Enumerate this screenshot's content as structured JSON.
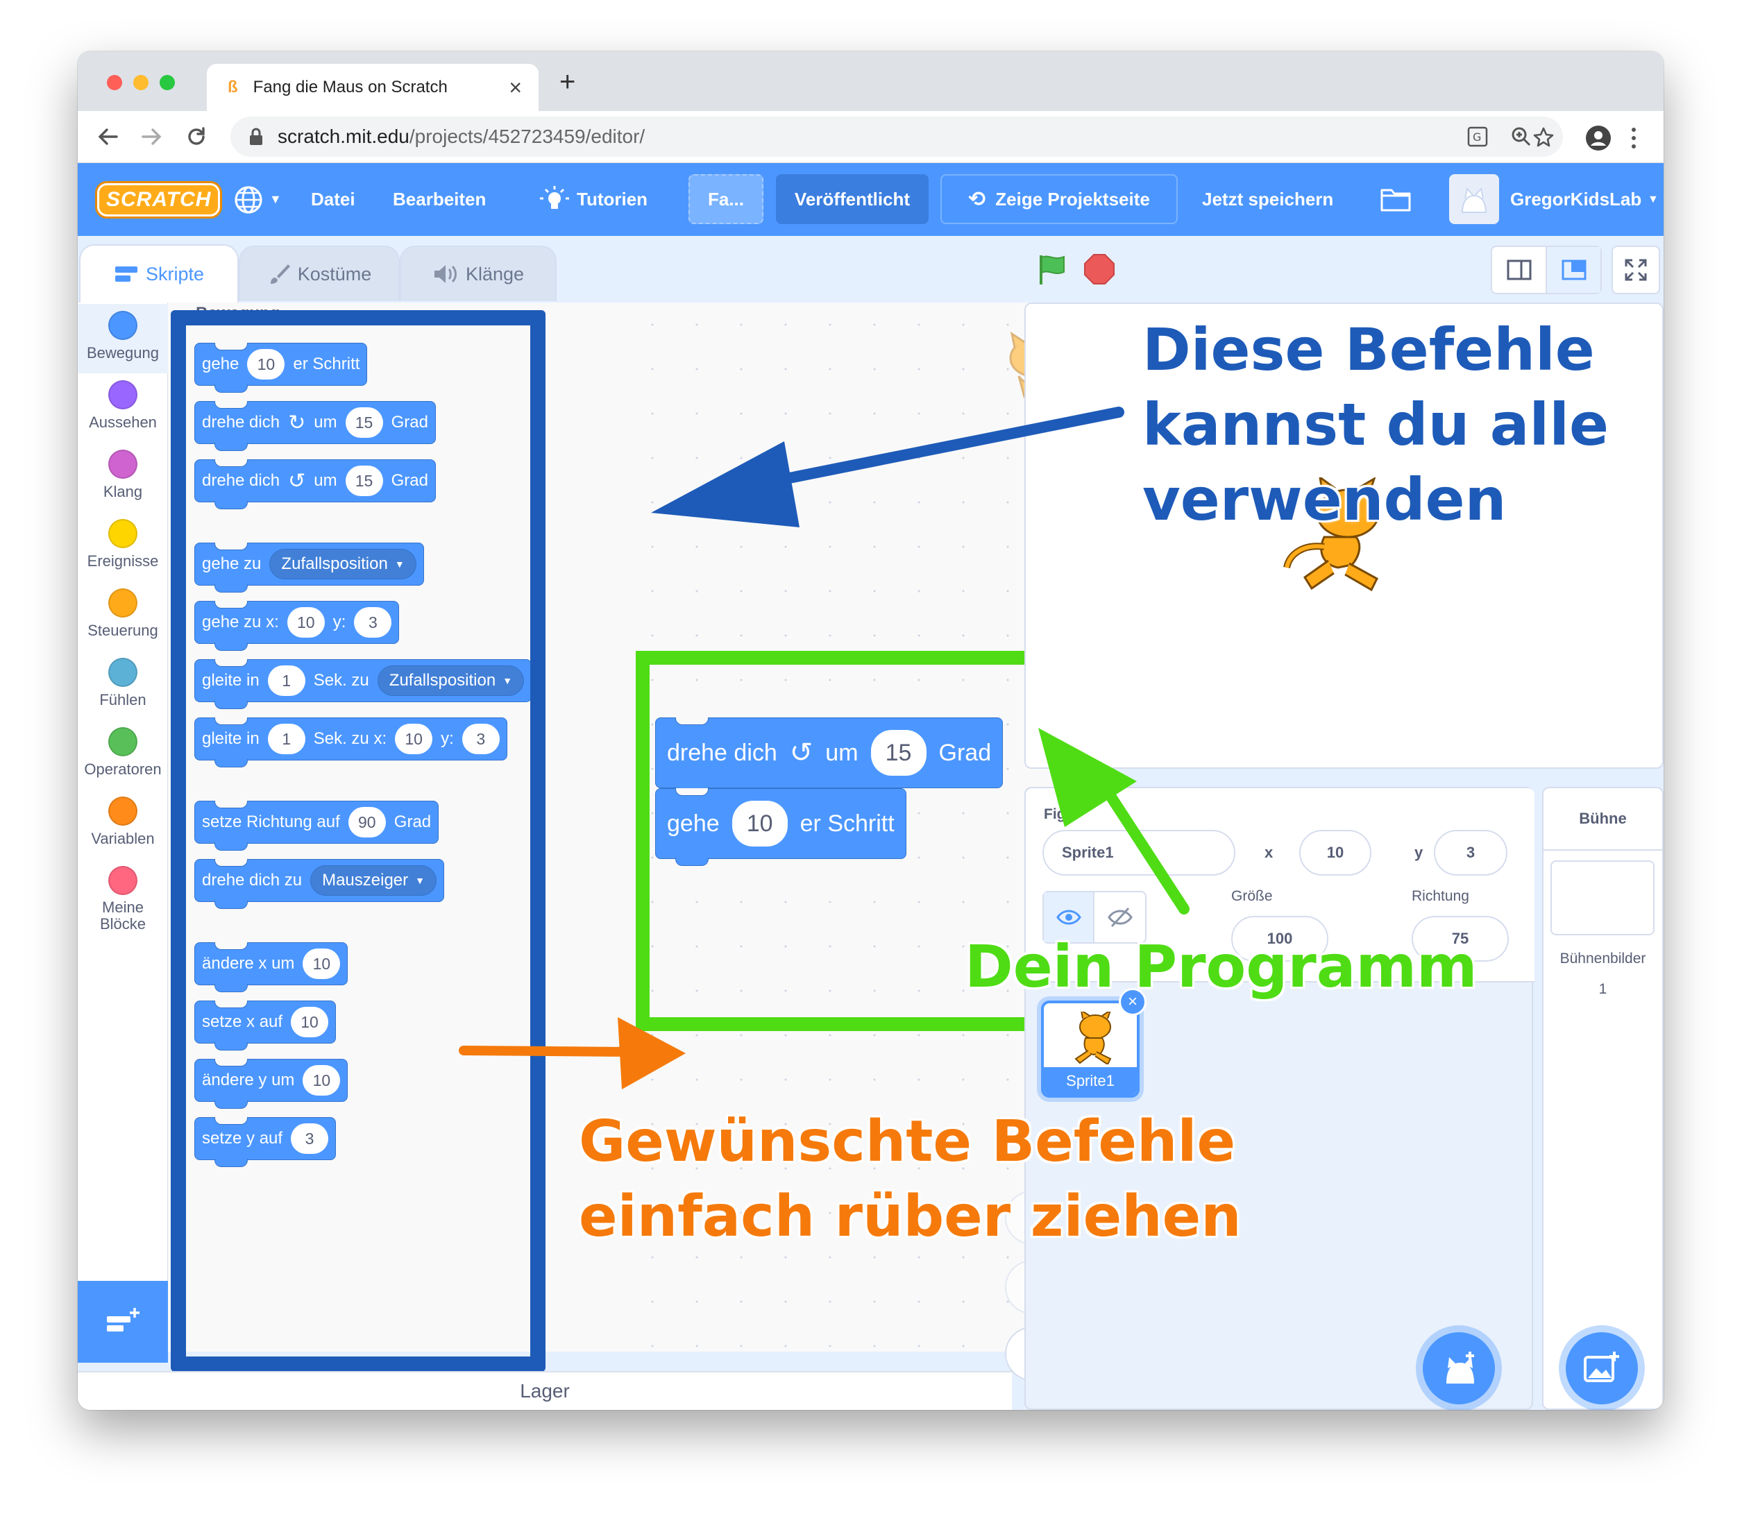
{
  "browser": {
    "tab_title": "Fang die Maus on Scratch",
    "tab_close": "×",
    "new_tab": "+",
    "url_host": "scratch.mit.edu",
    "url_path": "/projects/452723459/editor/"
  },
  "menubar": {
    "logo": "SCRATCH",
    "file": "Datei",
    "edit": "Bearbeiten",
    "tutorials": "Tutorien",
    "project_title": "Fa...",
    "shared": "Veröffentlicht",
    "see_project": "Zeige Projektseite",
    "save_now": "Jetzt speichern",
    "username": "GregorKidsLab"
  },
  "editor_tabs": {
    "code": "Skripte",
    "costumes": "Kostüme",
    "sounds": "Klänge"
  },
  "categories": [
    {
      "label": "Bewegung",
      "color": "#4c97ff"
    },
    {
      "label": "Aussehen",
      "color": "#9966ff"
    },
    {
      "label": "Klang",
      "color": "#cf63cf"
    },
    {
      "label": "Ereignisse",
      "color": "#ffd500"
    },
    {
      "label": "Steuerung",
      "color": "#ffab19"
    },
    {
      "label": "Fühlen",
      "color": "#5cb1d6"
    },
    {
      "label": "Operatoren",
      "color": "#59c059"
    },
    {
      "label": "Variablen",
      "color": "#ff8c1a"
    },
    {
      "label": "Meine Blöcke",
      "color": "#ff6680"
    }
  ],
  "palette": {
    "heading": "Bewegung",
    "b1": {
      "a": "gehe",
      "v": "10",
      "b": "er Schritt"
    },
    "b2": {
      "a": "drehe dich",
      "b": "um",
      "v": "15",
      "c": "Grad"
    },
    "b3": {
      "a": "drehe dich",
      "b": "um",
      "v": "15",
      "c": "Grad"
    },
    "b4": {
      "a": "gehe zu",
      "d": "Zufallsposition"
    },
    "b5": {
      "a": "gehe zu x:",
      "v1": "10",
      "b": "y:",
      "v2": "3"
    },
    "b6": {
      "a": "gleite in",
      "v": "1",
      "b": "Sek. zu",
      "d": "Zufallsposition"
    },
    "b7": {
      "a": "gleite in",
      "v": "1",
      "b": "Sek. zu x:",
      "v1": "10",
      "c": "y:",
      "v2": "3"
    },
    "b8": {
      "a": "setze Richtung auf",
      "v": "90",
      "b": "Grad"
    },
    "b9": {
      "a": "drehe dich zu",
      "d": "Mauszeiger"
    },
    "b10": {
      "a": "ändere x um",
      "v": "10"
    },
    "b11": {
      "a": "setze x auf",
      "v": "10"
    },
    "b12": {
      "a": "ändere y um",
      "v": "10"
    },
    "b13": {
      "a": "setze y auf",
      "v": "3"
    }
  },
  "script": {
    "s1": {
      "a": "drehe dich",
      "b": "um",
      "v": "15",
      "c": "Grad"
    },
    "s2": {
      "a": "gehe",
      "v": "10",
      "b": "er Schritt"
    }
  },
  "zoom_reset": "=",
  "storage": "Lager",
  "sprite_info": {
    "sprite_label": "Figur",
    "sprite_name": "Sprite1",
    "x_label": "x",
    "x": "10",
    "y_label": "y",
    "y": "3",
    "size_label": "Größe",
    "size": "100",
    "direction_label": "Richtung",
    "direction": "75"
  },
  "sprite_tile": {
    "name": "Sprite1"
  },
  "stage_panel": {
    "title": "Bühne",
    "backdrops_label": "Bühnenbilder",
    "backdrops_count": "1"
  },
  "annotations": {
    "blue": [
      "Diese Befehle",
      "kannst du alle",
      "verwenden"
    ],
    "green": "Dein Programm",
    "orange": [
      "Gewünschte Befehle",
      "einfach rüber ziehen"
    ],
    "blue_color": "#1e5bb8",
    "green_color": "#4fdc14",
    "orange_color": "#f57a0b"
  }
}
